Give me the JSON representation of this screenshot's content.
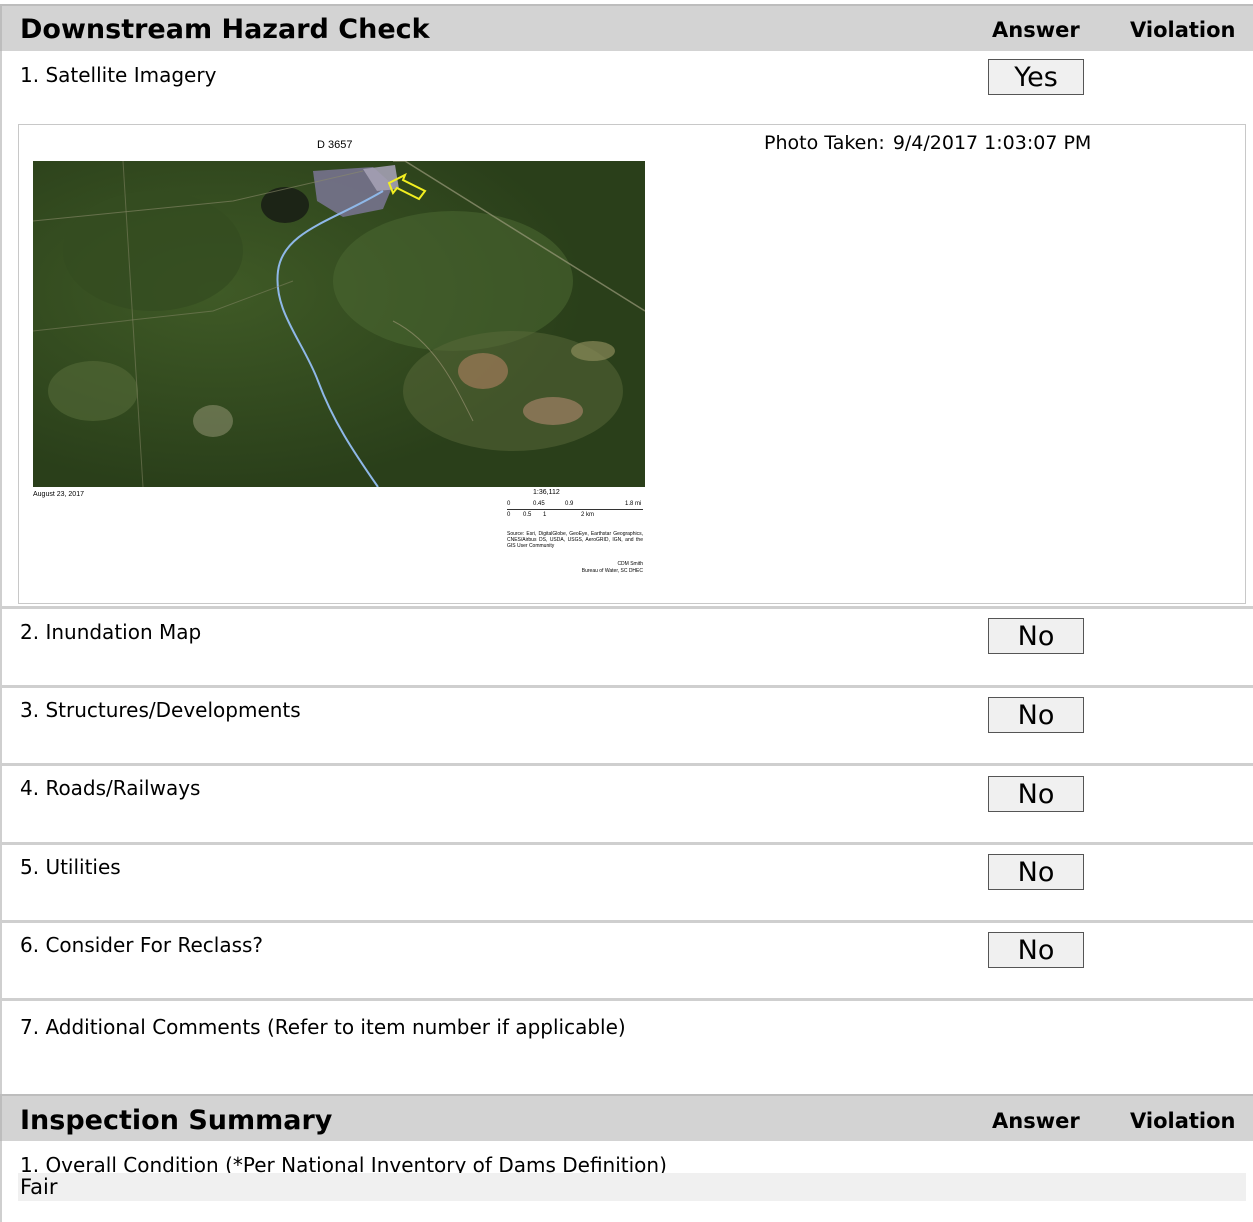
{
  "hazard": {
    "title": "Downstream Hazard Check",
    "answer_header": "Answer",
    "violation_header": "Violation",
    "items": [
      {
        "label": "1. Satellite Imagery",
        "answer": "Yes"
      },
      {
        "label": "2. Inundation Map",
        "answer": "No"
      },
      {
        "label": "3. Structures/Developments",
        "answer": "No"
      },
      {
        "label": "4. Roads/Railways",
        "answer": "No"
      },
      {
        "label": "5. Utilities",
        "answer": "No"
      },
      {
        "label": "6. Consider For Reclass?",
        "answer": "No"
      },
      {
        "label": "7. Additional Comments (Refer to item number if applicable)"
      }
    ],
    "photo": {
      "taken_label": "Photo Taken:",
      "taken_value": "9/4/2017 1:03:07 PM",
      "map_title": "D 3657",
      "map_date": "August 23, 2017",
      "scale": "1:36,112",
      "scale_mi": [
        "0",
        "0.45",
        "0.9",
        "1.8 mi"
      ],
      "scale_km": [
        "0",
        "0.5",
        "1",
        "2 km"
      ],
      "source": "Source: Esri, DigitalGlobe, GeoEye, Earthstar Geographics, CNES/Airbus DS, USDA, USGS, AeroGRID, IGN, and the GIS User Community",
      "credit_line1": "CDM Smith",
      "credit_line2": "Bureau of Water, SC DHEC"
    }
  },
  "summary": {
    "title": "Inspection Summary",
    "answer_header": "Answer",
    "violation_header": "Violation",
    "item1_label": "1. Overall Condition (*Per National Inventory of Dams Definition)",
    "item1_value": "Fair"
  }
}
